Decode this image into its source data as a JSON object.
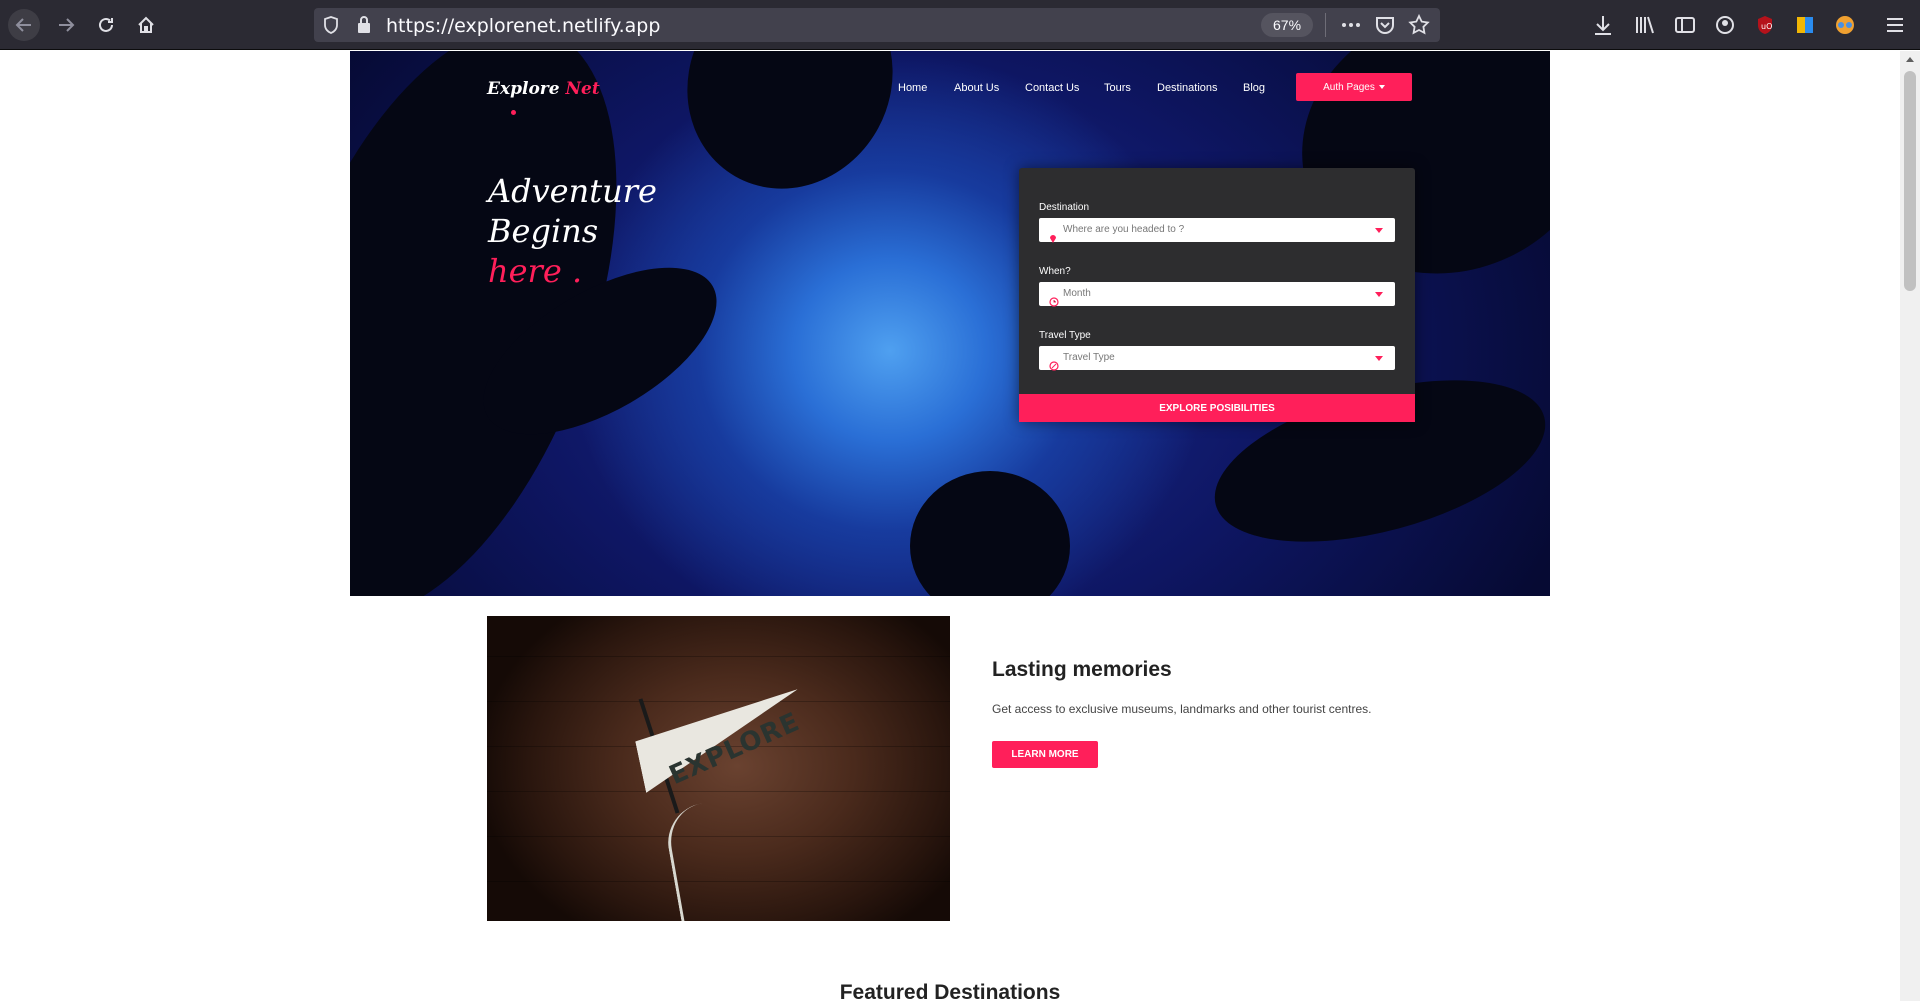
{
  "browser": {
    "url": "https://explorenet.netlify.app",
    "zoom": "67%"
  },
  "site": {
    "logo": {
      "part1": "Explore ",
      "part2": "Net"
    },
    "nav": [
      "Home",
      "About Us",
      "Contact Us",
      "Tours",
      "Destinations",
      "Blog"
    ],
    "auth_button": "Auth Pages",
    "tagline": {
      "line1": "Adventure",
      "line2": "Begins",
      "line3": "here ."
    },
    "form": {
      "destination_label": "Destination",
      "destination_placeholder": "Where are you headed to ?",
      "when_label": "When?",
      "when_placeholder": "Month",
      "type_label": "Travel Type",
      "type_placeholder": "Travel Type",
      "submit": "EXPLORE POSIBILITIES"
    },
    "memories": {
      "image_text": "EXPLORE",
      "title": "Lasting memories",
      "text": "Get access to exclusive museums, landmarks and other tourist centres.",
      "button": "LEARN MORE"
    },
    "featured_title": "Featured Destinations"
  },
  "colors": {
    "accent": "#ff1f5a",
    "chrome": "#2b2a33",
    "form_bg": "#2d2d2f"
  }
}
